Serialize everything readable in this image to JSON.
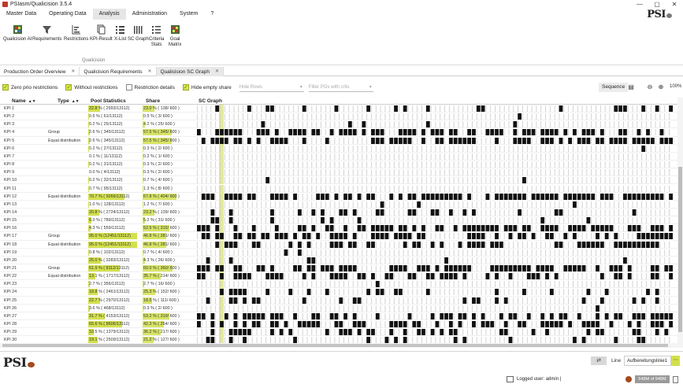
{
  "window": {
    "title": "PSIasm/Qualicision 3.5.4",
    "controls": [
      "—",
      "▢",
      "✕"
    ]
  },
  "menu": {
    "items": [
      "Master Data",
      "Operating Data",
      "Analysis",
      "Administration",
      "System",
      "?"
    ],
    "active_index": 2
  },
  "brand": "PSI",
  "ribbon": {
    "group_label": "Qualicision",
    "buttons": [
      {
        "label": "Qualicision AI",
        "icon": "qualicision-ai-icon"
      },
      {
        "label": "Requirements",
        "icon": "funnel-icon"
      },
      {
        "label": "Restrictions",
        "icon": "restrictions-icon"
      },
      {
        "label": "KPI-Result",
        "icon": "kpi-result-icon"
      },
      {
        "label": "X-List",
        "icon": "x-list-icon"
      },
      {
        "label": "SC Graph",
        "icon": "sc-graph-icon"
      },
      {
        "label": "Criteria\nStats",
        "icon": "criteria-stats-icon"
      },
      {
        "label": "Goal\nMatrix",
        "icon": "goal-matrix-icon"
      }
    ]
  },
  "tabs": [
    {
      "label": "Production Order Overview",
      "active": false
    },
    {
      "label": "Qualicision Requirements",
      "active": false
    },
    {
      "label": "Qualicision SC Graph",
      "active": true
    }
  ],
  "toolbar": {
    "checkboxes": [
      {
        "label": "Zero prio restrictions",
        "checked": true
      },
      {
        "label": "Without restrictions",
        "checked": true
      },
      {
        "label": "Restriction details",
        "checked": false
      },
      {
        "label": "Hide empty share",
        "checked": true
      }
    ],
    "hide_rows_placeholder": "Hide Rows",
    "filter_placeholder": "Filter POs with crits",
    "sequence_label": "Sequence",
    "zoom_level": "100%"
  },
  "grid": {
    "headers": {
      "name": "Name",
      "type": "Type",
      "pool": "Pool Statistics",
      "share": "Share",
      "graph": "SC Graph"
    },
    "rows": [
      {
        "name": "KPI 1",
        "type": "",
        "pool": "22.8 % ( 2993/13112)",
        "pool_frac": 0.228,
        "share": "23.0 % ( 138/ 600 )",
        "share_frac": 0.23
      },
      {
        "name": "KPI 2",
        "type": "",
        "pool": "0.5 % ( 61/13112)",
        "pool_frac": 0.005,
        "share": "0.5 % ( 3/ 600 )",
        "share_frac": 0.005
      },
      {
        "name": "KPI 3",
        "type": "",
        "pool": "0.2 % ( 25/13112)",
        "pool_frac": 0.002,
        "share": "4.2 % ( 25/ 600 )",
        "share_frac": 0.042
      },
      {
        "name": "KPI 4",
        "type": "Group",
        "pool": "2.6 % ( 345/13112)",
        "pool_frac": 0.026,
        "share": "57.5 % ( 345/ 600 )",
        "share_frac": 0.575
      },
      {
        "name": "KPI 5",
        "type": "Equal distribution",
        "pool": "2.6 % ( 345/13112)",
        "pool_frac": 0.026,
        "share": "57.5 % ( 345/ 600 )",
        "share_frac": 0.575
      },
      {
        "name": "KPI 6",
        "type": "",
        "pool": "0.2 % ( 27/13112)",
        "pool_frac": 0.002,
        "share": "0.3 % ( 2/ 600 )",
        "share_frac": 0.003
      },
      {
        "name": "KPI 7",
        "type": "",
        "pool": "0.1 % ( 11/13112)",
        "pool_frac": 0.001,
        "share": "0.2 % ( 1/ 600 )",
        "share_frac": 0.002
      },
      {
        "name": "KPI 8",
        "type": "",
        "pool": "0.2 % ( 31/13112)",
        "pool_frac": 0.002,
        "share": "0.3 % ( 2/ 600 )",
        "share_frac": 0.003
      },
      {
        "name": "KPI 9",
        "type": "",
        "pool": "0.0 % ( 4/13112)",
        "pool_frac": 0.0,
        "share": "0.3 % ( 2/ 600 )",
        "share_frac": 0.003
      },
      {
        "name": "KPI 10",
        "type": "",
        "pool": "0.2 % ( 32/13112)",
        "pool_frac": 0.002,
        "share": "0.7 % ( 4/ 600 )",
        "share_frac": 0.007
      },
      {
        "name": "KPI 11",
        "type": "",
        "pool": "0.7 % ( 95/13112)",
        "pool_frac": 0.007,
        "share": "1.3 % ( 8/ 600 )",
        "share_frac": 0.013
      },
      {
        "name": "KPI 12",
        "type": "Equal distribution",
        "pool": "70.7 % ( 9266/13112)",
        "pool_frac": 0.707,
        "share": "67.8 % ( 404/ 600 )",
        "share_frac": 0.678
      },
      {
        "name": "KPI 13",
        "type": "",
        "pool": "1.0 % ( 128/13112)",
        "pool_frac": 0.01,
        "share": "1.2 % ( 7/ 600 )",
        "share_frac": 0.012
      },
      {
        "name": "KPI 14",
        "type": "",
        "pool": "20.8 % ( 2724/13112)",
        "pool_frac": 0.208,
        "share": "23.2 % ( 139/ 600 )",
        "share_frac": 0.232
      },
      {
        "name": "KPI 15",
        "type": "",
        "pool": "6.0 % ( 789/13112)",
        "pool_frac": 0.06,
        "share": "5.2 % ( 31/ 600 )",
        "share_frac": 0.052
      },
      {
        "name": "KPI 16",
        "type": "",
        "pool": "4.3 % ( 559/13112)",
        "pool_frac": 0.043,
        "share": "52.5 % ( 315/ 600 )",
        "share_frac": 0.525
      },
      {
        "name": "KPI 17",
        "type": "Group",
        "pool": "95.0 % (12451/13112)",
        "pool_frac": 0.95,
        "share": "46.8 % ( 281/ 600 )",
        "share_frac": 0.468
      },
      {
        "name": "KPI 18",
        "type": "Equal distribution",
        "pool": "95.0 % (12451/13112)",
        "pool_frac": 0.95,
        "share": "46.8 % ( 281/ 600 )",
        "share_frac": 0.468
      },
      {
        "name": "KPI 19",
        "type": "",
        "pool": "0.8 % ( 102/13112)",
        "pool_frac": 0.008,
        "share": "0.7 % ( 4/ 600 )",
        "share_frac": 0.007
      },
      {
        "name": "KPI 20",
        "type": "",
        "pool": "25.0 % ( 3283/13112)",
        "pool_frac": 0.25,
        "share": "4.3 % ( 26/ 600 )",
        "share_frac": 0.043
      },
      {
        "name": "KPI 21",
        "type": "Group",
        "pool": "61.9 % ( 8112/13112)",
        "pool_frac": 0.619,
        "share": "60.0 % ( 360/ 600 )",
        "share_frac": 0.6
      },
      {
        "name": "KPI 22",
        "type": "Equal distribution",
        "pool": "13.1 % ( 1717/13112)",
        "pool_frac": 0.131,
        "share": "35.7 % ( 214/ 600 )",
        "share_frac": 0.357
      },
      {
        "name": "KPI 23",
        "type": "",
        "pool": "2.7 % ( 356/13112)",
        "pool_frac": 0.027,
        "share": "2.7 % ( 16/ 600 )",
        "share_frac": 0.027
      },
      {
        "name": "KPI 24",
        "type": "",
        "pool": "18.8 % ( 2461/13112)",
        "pool_frac": 0.188,
        "share": "25.3 % ( 152/ 600 )",
        "share_frac": 0.253
      },
      {
        "name": "KPI 25",
        "type": "",
        "pool": "22.7 % ( 2970/13112)",
        "pool_frac": 0.227,
        "share": "18.5 % ( 111/ 600 )",
        "share_frac": 0.185
      },
      {
        "name": "KPI 26",
        "type": "",
        "pool": "3.6 % ( 468/13112)",
        "pool_frac": 0.036,
        "share": "0.3 % ( 2/ 600 )",
        "share_frac": 0.003
      },
      {
        "name": "KPI 27",
        "type": "",
        "pool": "31.7 % ( 4153/13112)",
        "pool_frac": 0.317,
        "share": "53.2 % ( 319/ 600 )",
        "share_frac": 0.532
      },
      {
        "name": "KPI 28",
        "type": "",
        "pool": "65.6 % ( 8606/13112)",
        "pool_frac": 0.656,
        "share": "42.3 % ( 254/ 600 )",
        "share_frac": 0.423
      },
      {
        "name": "KPI 29",
        "type": "",
        "pool": "10.5 % ( 1379/13112)",
        "pool_frac": 0.105,
        "share": "36.2 % ( 217/ 600 )",
        "share_frac": 0.362
      },
      {
        "name": "KPI 30",
        "type": "",
        "pool": "19.1 % ( 2509/13112)",
        "pool_frac": 0.191,
        "share": "21.2 % ( 127/ 600 )",
        "share_frac": 0.212
      }
    ]
  },
  "bottom": {
    "line_label": "Line",
    "line_value": "Aufbereitungslinie1",
    "logged_user": "Logged user: admin |",
    "memory": "648M of 948M"
  },
  "colors": {
    "accent": "#d3e04d",
    "highlight_column": "#e3ea9a",
    "mark": "#111111",
    "divider": "#c9c9c9"
  }
}
